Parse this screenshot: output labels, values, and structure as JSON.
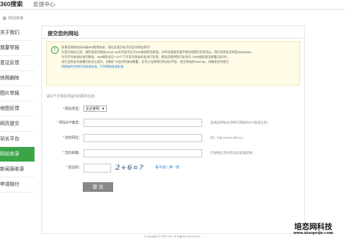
{
  "header": {
    "logo_text": "360搜索",
    "link": "反馈中心"
  },
  "breadcrumb": "网站收录",
  "sidebar": {
    "items": [
      {
        "label": "关于我们"
      },
      {
        "label": "我要举报"
      },
      {
        "label": "意见反馈"
      },
      {
        "label": "快照删除"
      },
      {
        "label": "图片举报"
      },
      {
        "label": "地图反馈"
      },
      {
        "label": "网页提交"
      },
      {
        "label": "站长平台"
      },
      {
        "label": "网站收录"
      },
      {
        "label": "新闻源收录"
      },
      {
        "label": "申请赔付"
      }
    ]
  },
  "main": {
    "title": "提交您的网站",
    "notice_lines": [
      "如果您的网站尚未被360搜索收录，请在此提交站点的首页网址即可！",
      "在提交网站之前，请检查您的网站robots.txt文件是否允许360搜索爬虫抓取，同时注意服务器不要封禁我们的爬虫ip。我们的爬虫名称是360spider。",
      "对于符合收录标准的网站，360搜索会在7-10个工作日内收录标准进行处理，建议您使用我们发布的《360搜索网页质量白皮书》，",
      "进行自检站点质量的优化与提升。如果扩大站点的收录数量，您可以注册我们的站长平台，提交网站的sitemap，请确保您所提交",
      "的网站符合我们的收录标准。打开网站收录标准"
    ],
    "form_intro": "请在下方填写您提交的网页信息:",
    "fields": {
      "site_type": {
        "label": "网站类型：",
        "value": "企业官网"
      },
      "icp": {
        "label": "网站ICP备案：",
        "value": "",
        "hint": "（此类型网站必须填写网站的ICP备案信息）"
      },
      "url": {
        "label": "您的网址：",
        "value": "",
        "hint": "（如：http://www.360.cn）"
      },
      "email": {
        "label": "您的邮箱：",
        "value": "",
        "hint": "（方便我们及时告知您处理结果）"
      },
      "captcha": {
        "label": "验证码：",
        "value": "",
        "image_text": "2+6=?",
        "refresh": "看不清？换一张"
      }
    },
    "submit_label": "提 交"
  },
  "footer": "Copyright © 360.CN All Rights Reserved.",
  "watermark": {
    "title": "培恋网科技",
    "url": "www.xiaopeijx.com"
  },
  "colors": {
    "accent": "#3aa447",
    "link": "#2b7bd1",
    "notice_bg": "#fffbe6"
  }
}
